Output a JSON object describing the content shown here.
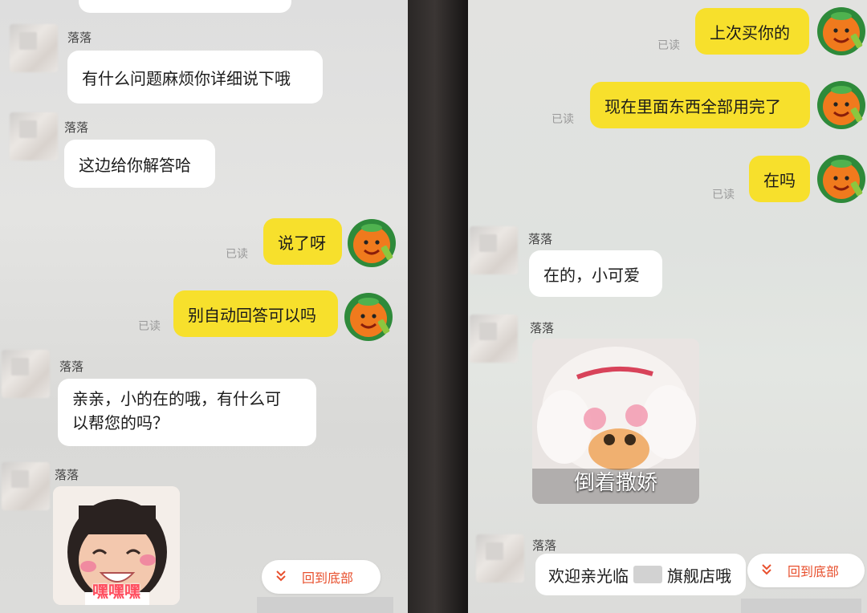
{
  "left": {
    "messages": [
      {
        "sender": "落落",
        "text": "有什么问题麻烦你详细说下哦"
      },
      {
        "sender": "落落",
        "text": "这边给你解答哈"
      },
      {
        "text": "说了呀",
        "read": "已读"
      },
      {
        "text": "别自动回答可以吗",
        "read": "已读"
      },
      {
        "sender": "落落",
        "line1": "亲亲，小的在的哦，有什么可",
        "line2": "以帮您的吗？"
      },
      {
        "sender": "落落",
        "sticker_caption": "嘿嘿嘿"
      }
    ],
    "back_to_bottom": "回到底部"
  },
  "right": {
    "messages": [
      {
        "text": "上次买你的",
        "read": "已读"
      },
      {
        "text": "现在里面东西全部用完了",
        "read": "已读"
      },
      {
        "text": "在吗",
        "read": "已读"
      },
      {
        "sender": "落落",
        "text": "在的，小可爱"
      },
      {
        "sender": "落落",
        "sticker_caption": "倒着撒娇"
      },
      {
        "sender": "落落",
        "text_before": "欢迎亲光临",
        "text_after": "旗舰店哦"
      }
    ],
    "back_to_bottom": "回到底部"
  },
  "colors": {
    "outgoing_bubble": "#f7e02c",
    "incoming_bubble": "#ffffff",
    "accent": "#e8502e"
  },
  "icons": {
    "user_avatar": "orange-mascot-icon",
    "scroll_bottom": "chevron-double-down-icon"
  }
}
